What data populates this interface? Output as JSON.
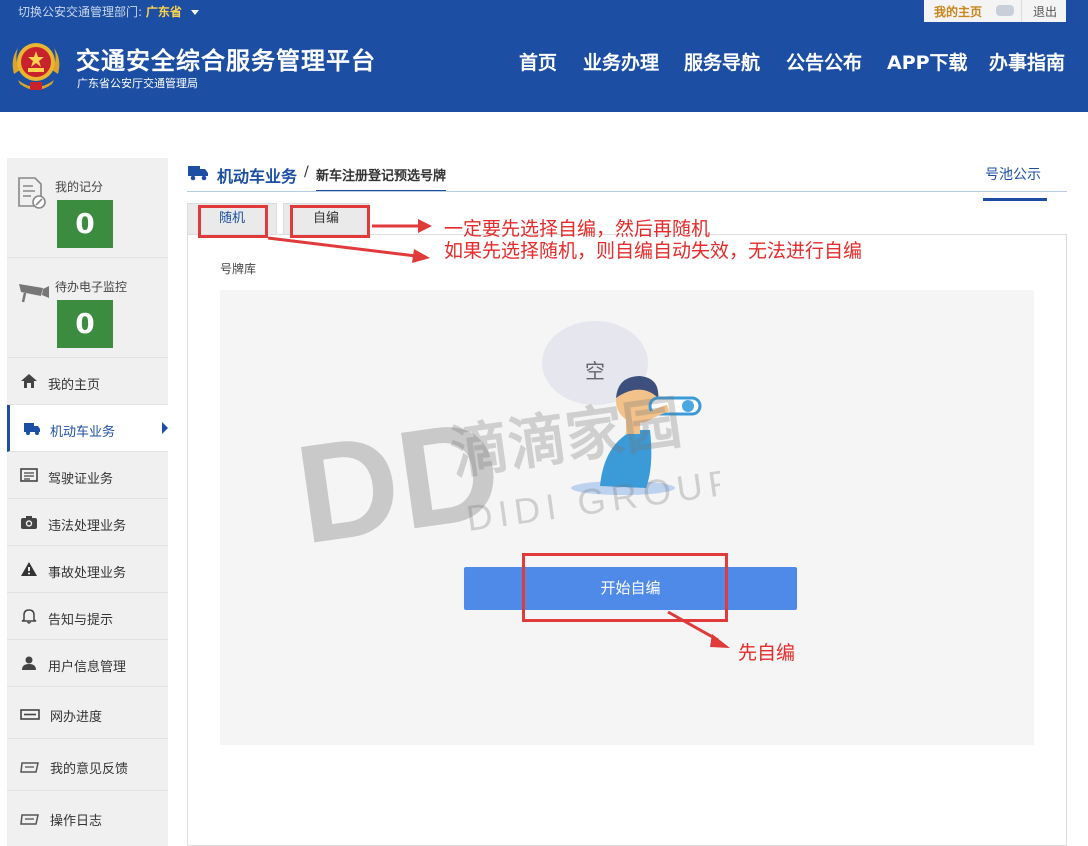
{
  "topbar": {
    "switch_label": "切换公安交通管理部门:",
    "province": "广东省",
    "my_home": "我的主页",
    "logout": "退出"
  },
  "header": {
    "title": "交通安全综合服务管理平台",
    "subtitle": "广东省公安厅交通管理局",
    "nav": [
      "首页",
      "业务办理",
      "服务导航",
      "公告公布",
      "APP下载",
      "办事指南"
    ]
  },
  "sidebar": {
    "stats": [
      {
        "label": "我的记分",
        "count": "0",
        "icon": "document-edit-icon"
      },
      {
        "label": "待办电子监控",
        "count": "0",
        "icon": "camera-monitor-icon"
      }
    ],
    "items": [
      {
        "label": "我的主页",
        "icon": "home-icon"
      },
      {
        "label": "机动车业务",
        "icon": "truck-icon",
        "active": true
      },
      {
        "label": "驾驶证业务",
        "icon": "id-card-icon"
      },
      {
        "label": "违法处理业务",
        "icon": "camera-icon"
      },
      {
        "label": "事故处理业务",
        "icon": "warning-icon"
      },
      {
        "label": "告知与提示",
        "icon": "bell-icon"
      },
      {
        "label": "用户信息管理",
        "icon": "user-icon"
      },
      {
        "label": "网办进度",
        "icon": "progress-icon"
      },
      {
        "label": "我的意见反馈",
        "icon": "feedback-icon"
      },
      {
        "label": "操作日志",
        "icon": "log-icon"
      }
    ]
  },
  "breadcrumb": {
    "main": "机动车业务",
    "separator": "/",
    "sub": "新车注册登记预选号牌"
  },
  "pool_public": "号池公示",
  "tabs": {
    "random": "随机",
    "self": "自编"
  },
  "pool_label": "号牌库",
  "empty_text": "空",
  "start_button": "开始自编",
  "watermark": {
    "big": "DD",
    "cn": "滴滴家园",
    "en": "DIDI GROUP"
  },
  "annotations": {
    "line1": "一定要先选择自编，然后再随机",
    "line2": "如果先选择随机，则自编自动失效，无法进行自编",
    "line3": "先自编"
  },
  "colors": {
    "brand_blue": "#1c4fa3",
    "count_green": "#3c8c3f",
    "button_blue": "#4f8ae8",
    "annotation_red": "#e52b2b",
    "province_gold": "#ffd34d"
  }
}
